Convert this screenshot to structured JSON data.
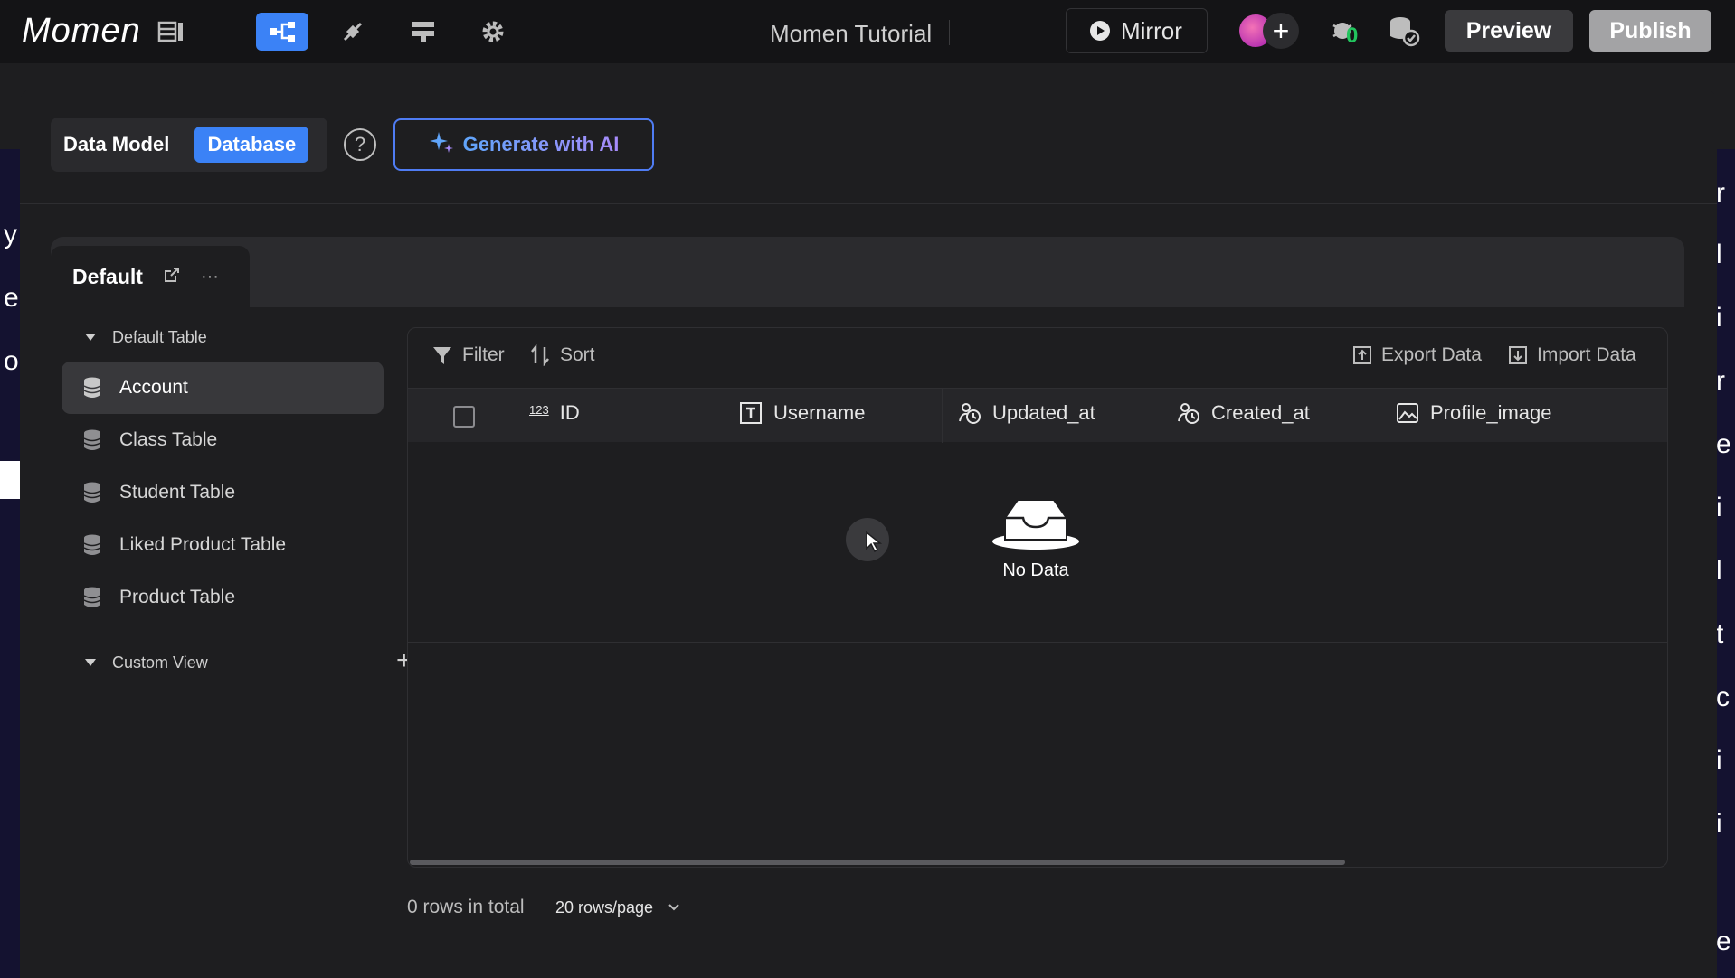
{
  "app": {
    "logo_text": "Momen",
    "project_title": "Momen Tutorial",
    "mirror_label": "Mirror",
    "preview_label": "Preview",
    "publish_label": "Publish",
    "badge_count": "0",
    "avatar_add": "+"
  },
  "header": {
    "data_model_label": "Data Model",
    "database_label": "Database",
    "help_symbol": "?",
    "generate_ai_label": "Generate with AI"
  },
  "tab": {
    "label": "Default",
    "more": "···"
  },
  "sidebar": {
    "default_group_label": "Default Table",
    "items": [
      {
        "label": "Account"
      },
      {
        "label": "Class Table"
      },
      {
        "label": "Student Table"
      },
      {
        "label": "Liked Product Table"
      },
      {
        "label": "Product Table"
      }
    ],
    "custom_group_label": "Custom View",
    "add_symbol": "+"
  },
  "table": {
    "filter_label": "Filter",
    "sort_label": "Sort",
    "export_label": "Export Data",
    "import_label": "Import Data",
    "columns": [
      {
        "label": "ID",
        "type_badge": "123"
      },
      {
        "label": "Username"
      },
      {
        "label": "Updated_at"
      },
      {
        "label": "Created_at"
      },
      {
        "label": "Profile_image"
      }
    ],
    "empty_text": "No Data"
  },
  "footer": {
    "rows_total": "0 rows in total",
    "page_size": "20 rows/page"
  },
  "colors": {
    "accent": "#3b82f6",
    "topbar_bg": "#141416",
    "panel_bg": "#1e1e20"
  },
  "icons": [
    "layout-icon",
    "data-flow-icon",
    "plugin-icon",
    "actionflow-icon",
    "settings-icon",
    "play-icon",
    "bug-icon",
    "database-check-icon",
    "help-icon",
    "sparkle-icon",
    "open-external-icon",
    "database-icon",
    "filter-icon",
    "sort-icon",
    "export-icon",
    "import-icon",
    "text-type-icon",
    "datetime-icon",
    "image-icon",
    "empty-inbox-icon",
    "chevron-down-icon"
  ]
}
